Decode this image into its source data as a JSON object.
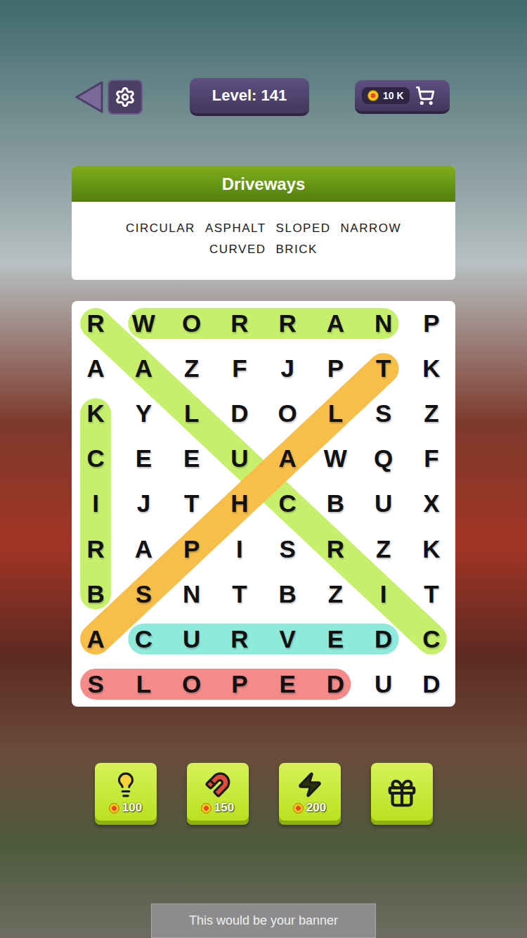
{
  "level": {
    "label": "Level: 141"
  },
  "coins": {
    "amount": "10 K"
  },
  "category": {
    "title": "Driveways"
  },
  "words": [
    "CIRCULAR",
    "ASPHALT",
    "SLOPED",
    "NARROW",
    "CURVED",
    "BRICK"
  ],
  "grid": {
    "rows": [
      [
        "R",
        "W",
        "O",
        "R",
        "R",
        "A",
        "N",
        "P"
      ],
      [
        "A",
        "A",
        "Z",
        "F",
        "J",
        "P",
        "T",
        "K"
      ],
      [
        "K",
        "Y",
        "L",
        "D",
        "O",
        "L",
        "S",
        "Z"
      ],
      [
        "C",
        "E",
        "E",
        "U",
        "A",
        "W",
        "Q",
        "F"
      ],
      [
        "I",
        "J",
        "T",
        "H",
        "C",
        "B",
        "U",
        "X"
      ],
      [
        "R",
        "A",
        "P",
        "I",
        "S",
        "R",
        "Z",
        "K"
      ],
      [
        "B",
        "S",
        "N",
        "T",
        "B",
        "Z",
        "I",
        "T"
      ],
      [
        "A",
        "C",
        "U",
        "R",
        "V",
        "E",
        "D",
        "C"
      ],
      [
        "S",
        "L",
        "O",
        "P",
        "E",
        "D",
        "U",
        "D"
      ]
    ]
  },
  "found": [
    {
      "word": "CIRCULAR",
      "color": "#c6f06c",
      "start": [
        7,
        7
      ],
      "end": [
        0,
        0
      ]
    },
    {
      "word": "ASPHALT",
      "color": "#f8be4a",
      "start": [
        7,
        0
      ],
      "end": [
        1,
        6
      ]
    },
    {
      "word": "NARROW",
      "color": "#c6f06c",
      "start": [
        0,
        6
      ],
      "end": [
        0,
        1
      ]
    },
    {
      "word": "BRICK",
      "color": "#c6f06c",
      "start": [
        6,
        0
      ],
      "end": [
        2,
        0
      ]
    },
    {
      "word": "CURVED",
      "color": "#8feadb",
      "start": [
        7,
        1
      ],
      "end": [
        7,
        6
      ]
    },
    {
      "word": "SLOPED",
      "color": "#f48b8b",
      "start": [
        8,
        0
      ],
      "end": [
        8,
        5
      ]
    }
  ],
  "powerups": [
    {
      "kind": "hint",
      "cost": "100"
    },
    {
      "kind": "magnet",
      "cost": "150"
    },
    {
      "kind": "bolt",
      "cost": "200"
    },
    {
      "kind": "video",
      "cost": ""
    }
  ],
  "banner": {
    "text": "This would be your banner"
  }
}
